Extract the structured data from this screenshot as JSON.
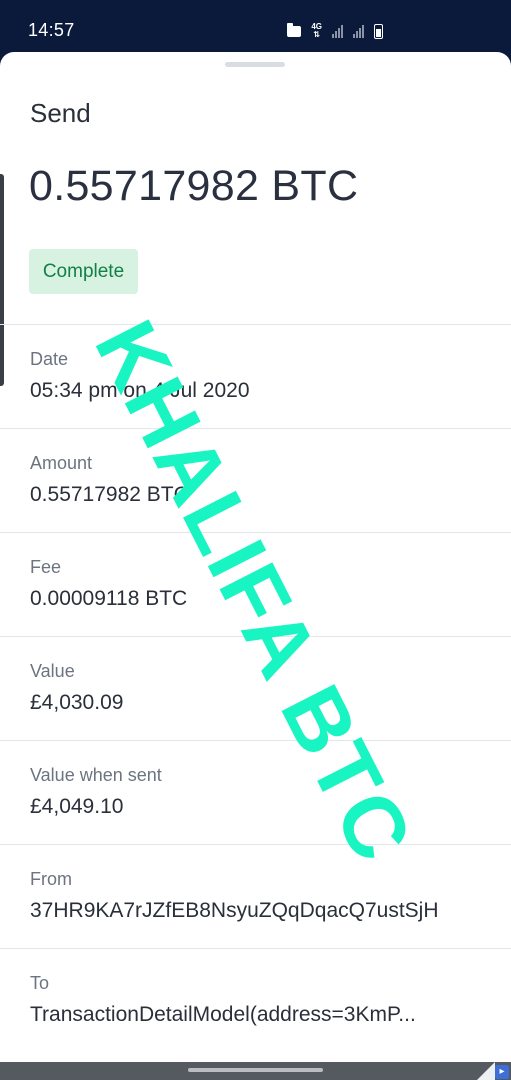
{
  "status_bar": {
    "time": "14:57",
    "network": "4G",
    "icons": [
      "folder-icon",
      "network-4g-icon",
      "signal-icon",
      "signal-icon",
      "battery-icon"
    ]
  },
  "header": {
    "title": "Send",
    "amount": "0.55717982 BTC",
    "status": "Complete",
    "status_color": "#138047"
  },
  "details": [
    {
      "label": "Date",
      "value": "05:34 pm on 4 Jul 2020"
    },
    {
      "label": "Amount",
      "value": "0.55717982 BTC"
    },
    {
      "label": "Fee",
      "value": "0.00009118 BTC"
    },
    {
      "label": "Value",
      "value": "£4,030.09"
    },
    {
      "label": "Value when sent",
      "value": "£4,049.10"
    },
    {
      "label": "From",
      "value": "37HR9KA7rJZfEB8NsyuZQqDqacQ7ustSjH"
    },
    {
      "label": "To",
      "value": "TransactionDetailModel(address=3KmP..."
    }
  ],
  "watermark": "KHALIFA BTC",
  "colors": {
    "status_bar_bg": "#0b1a3a",
    "badge_bg": "#d8f2e1",
    "watermark": "#19f5c2"
  }
}
